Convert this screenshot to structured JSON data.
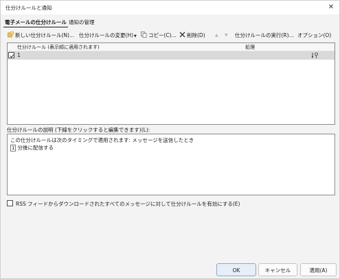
{
  "window": {
    "title": "仕分けルールと通知",
    "close_glyph": "✕"
  },
  "tabs": [
    {
      "label": "電子メールの仕分けルール",
      "active": true
    },
    {
      "label": "通知の管理",
      "active": false
    }
  ],
  "toolbar": {
    "new_rule": "新しい仕分けルール(N)...",
    "change_rule": "仕分けルールの変更(H)",
    "copy": "コピー(C)...",
    "delete": "削除(D)",
    "move_up_glyph": "▲",
    "move_down_glyph": "▼",
    "run_rules": "仕分けルールの実行(R)...",
    "options": "オプション(O)"
  },
  "rules_list": {
    "columns": [
      "仕分けルール (表示順に適用されます)",
      "処理"
    ],
    "rows": [
      {
        "name": "1",
        "enabled": true,
        "action_icon": "rule-action-icon"
      }
    ]
  },
  "description": {
    "label": "仕分けルールの説明 (下線をクリックすると編集できます)(L):",
    "line1": "この仕分けルールは次のタイミングで適用されます: メッセージを送信したとき",
    "line2_num": "1",
    "line2_text": "分後に配信する"
  },
  "rss": {
    "checked": false,
    "label": "RSS フィードからダウンロードされたすべてのメッセージに対して仕分けルールを有効にする(E)"
  },
  "buttons": {
    "ok": "OK",
    "cancel": "キャンセル",
    "apply": "適用(A)"
  },
  "colors": {
    "selected_row": "#d9d9d9",
    "primary_button_border": "#8aa8cf",
    "dialog_background": "#f3f3f3"
  }
}
